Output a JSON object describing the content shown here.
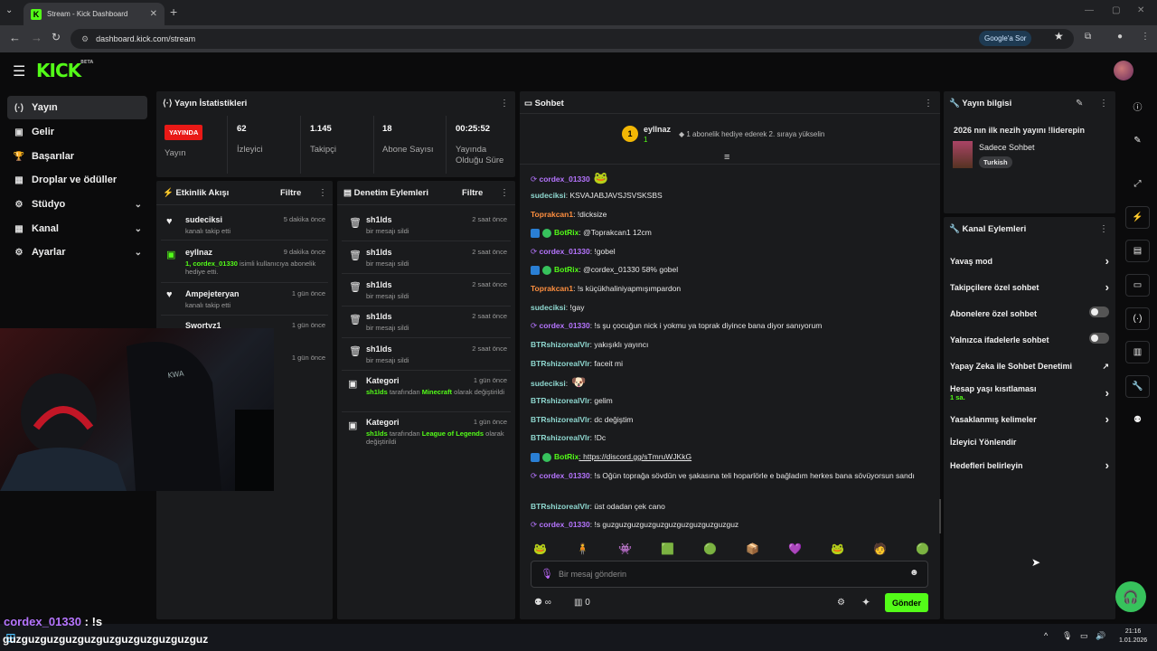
{
  "browser": {
    "tab_title": "Stream - Kick Dashboard",
    "url": "dashboard.kick.com/stream",
    "google_button": "Google'a Sor"
  },
  "header": {
    "logo": "KICK",
    "logo_tag": "BETA"
  },
  "sidebar": {
    "items": [
      {
        "label": "Yayın",
        "icon": "broadcast-icon",
        "active": true
      },
      {
        "label": "Gelir",
        "icon": "wallet-icon"
      },
      {
        "label": "Başarılar",
        "icon": "trophy-icon"
      },
      {
        "label": "Droplar ve ödüller",
        "icon": "gift-icon"
      },
      {
        "label": "Stüdyo",
        "icon": "studio-icon",
        "chevron": "⌄"
      },
      {
        "label": "Kanal",
        "icon": "grid-icon",
        "chevron": "⌄"
      },
      {
        "label": "Ayarlar",
        "icon": "gear-icon",
        "chevron": "⌄"
      }
    ]
  },
  "stats": {
    "title": "Yayın İstatistikleri",
    "live_badge": "YAYINDA",
    "live_label": "Yayın",
    "items": [
      {
        "value": "62",
        "label": "İzleyici"
      },
      {
        "value": "1.145",
        "label": "Takipçi"
      },
      {
        "value": "18",
        "label": "Abone Sayısı"
      },
      {
        "value": "00:25:52",
        "label": "Yayında Olduğu Süre"
      }
    ]
  },
  "activity": {
    "title": "Etkinlik Akışı",
    "filter": "Filtre",
    "items": [
      {
        "name": "sudeciksi",
        "sub": "kanalı takip etti",
        "time": "5 dakika önce"
      },
      {
        "name": "eyllnaz",
        "sub_green": "1, cordex_01330",
        "sub": " isimli kullanıcıya abonelik hediye etti.",
        "time": "9 dakika önce"
      },
      {
        "name": "Ampejeteryan",
        "sub": "kanalı takip etti",
        "time": "1 gün önce"
      },
      {
        "name": "Swortyz1",
        "sub": "",
        "time": "1 gün önce"
      },
      {
        "name": "",
        "sub": "",
        "time": "1 gün önce"
      }
    ]
  },
  "moderation": {
    "title": "Denetim Eylemleri",
    "filter": "Filtre",
    "items": [
      {
        "name": "sh1lds",
        "sub": "bir mesajı sildi",
        "time": "2 saat önce"
      },
      {
        "name": "sh1lds",
        "sub": "bir mesajı sildi",
        "time": "2 saat önce"
      },
      {
        "name": "sh1lds",
        "sub": "bir mesajı sildi",
        "time": "2 saat önce"
      },
      {
        "name": "sh1lds",
        "sub": "bir mesajı sildi",
        "time": "2 saat önce"
      },
      {
        "name": "sh1lds",
        "sub": "bir mesajı sildi",
        "time": "2 saat önce"
      }
    ],
    "categories": [
      {
        "name": "Kategori",
        "who": "sh1lds",
        "mid": " tarafından ",
        "game": "Minecraft",
        "end": " olarak değiştirildi",
        "time": "1 gün önce"
      },
      {
        "name": "Kategori",
        "who": "sh1lds",
        "mid": " tarafından ",
        "game": "League of Legends",
        "end": " olarak değiştirildi",
        "time": "1 gün önce"
      }
    ]
  },
  "chat": {
    "title": "Sohbet",
    "pinned_user": "eyllnaz",
    "pinned_rank": "1",
    "pinned_count": "1",
    "pinned_text": "1 abonelik hediye ederek 2. sıraya yükselin",
    "messages": [
      {
        "user": "cordex_01330",
        "cls": "uc",
        "text": "",
        "emote": "🐸"
      },
      {
        "user": "sudeciksi",
        "cls": "us",
        "text": ": KSVAJABJAVSJSVSKSBS"
      },
      {
        "user": "Toprakcan1",
        "cls": "ut",
        "text": ": !dicksize"
      },
      {
        "user": "BotRix",
        "cls": "ub",
        "text": ": @Toprakcan1 12cm",
        "bot": true
      },
      {
        "user": "cordex_01330",
        "cls": "uc",
        "text": ": !gobel"
      },
      {
        "user": "BotRix",
        "cls": "ub",
        "text": ": @cordex_01330 58% gobel",
        "bot": true
      },
      {
        "user": "Toprakcan1",
        "cls": "ut",
        "text": ": !s küçükhaliniyapmışımpardon"
      },
      {
        "user": "sudeciksi",
        "cls": "us",
        "text": ": !gay"
      },
      {
        "user": "cordex_01330",
        "cls": "uc",
        "text": ": !s şu çocuğun nick i yokmu ya toprak diyince bana diyor sanıyorum"
      },
      {
        "user": "BTRshizorealVlr",
        "cls": "ubt",
        "text": ": yakışıklı yayıncı"
      },
      {
        "user": "BTRshizorealVlr",
        "cls": "ubt",
        "text": ": faceit mi"
      },
      {
        "user": "sudeciksi",
        "cls": "us",
        "text": ":",
        "emote": "🐶"
      },
      {
        "user": "BTRshizorealVlr",
        "cls": "ubt",
        "text": ": gelim"
      },
      {
        "user": "BTRshizorealVlr",
        "cls": "ubt",
        "text": ": dc değiştim"
      },
      {
        "user": "BTRshizorealVlr",
        "cls": "ubt",
        "text": ": !Dc"
      },
      {
        "user": "BotRix",
        "cls": "ub",
        "text": ": https://discord.gg/sTmruWJKkG",
        "bot": true
      },
      {
        "user": "cordex_01330",
        "cls": "uc",
        "text": ": !s Oğün toprağa sövdün ve şakasına teli hoparlörle e bağladım herkes bana sövüyorsun sandı"
      },
      {
        "user": "BTRshizorealVlr",
        "cls": "ubt",
        "text": ": üst odadan çek cano"
      },
      {
        "user": "cordex_01330",
        "cls": "uc",
        "text": ": !s guzguzguzguzguzguzguzguzguzguzguz"
      }
    ],
    "emotes": [
      "🐸",
      "🧍",
      "👾",
      "🟩",
      "🟢",
      "📦",
      "💜",
      "🐸",
      "🧑",
      "🟢"
    ],
    "input_placeholder": "Bir mesaj gönderin",
    "points": "∞",
    "sub_count": "0",
    "send_label": "Gönder"
  },
  "stream_info": {
    "title": "Yayın bilgisi",
    "stream_title": "2026 nın ilk nezih yayını !liderepin",
    "category": "Sadece Sohbet",
    "tag": "Turkish"
  },
  "channel_actions": {
    "title": "Kanal Eylemleri",
    "items": [
      {
        "label": "Yavaş mod",
        "type": "chevron"
      },
      {
        "label": "Takipçilere özel sohbet",
        "type": "chevron"
      },
      {
        "label": "Abonelere özel sohbet",
        "type": "toggle"
      },
      {
        "label": "Yalnızca ifadelerle sohbet",
        "type": "toggle"
      },
      {
        "label": "Yapay Zeka ile Sohbet Denetimi",
        "type": "external"
      },
      {
        "label": "Hesap yaşı kısıtlaması",
        "sub": "1 sa.",
        "type": "chevron"
      },
      {
        "label": "Yasaklanmış kelimeler",
        "type": "chevron"
      },
      {
        "label": "İzleyici Yönlendir",
        "type": "none"
      },
      {
        "label": "Hedefleri belirleyin",
        "type": "chevron"
      }
    ]
  },
  "overlay": {
    "user": "cordex_01330",
    "suffix": " : !s",
    "line2": "guzguzguzguzguzguzguzguzguzguzguz"
  },
  "taskbar": {
    "time": "21:16",
    "date": "1.01.2026"
  }
}
